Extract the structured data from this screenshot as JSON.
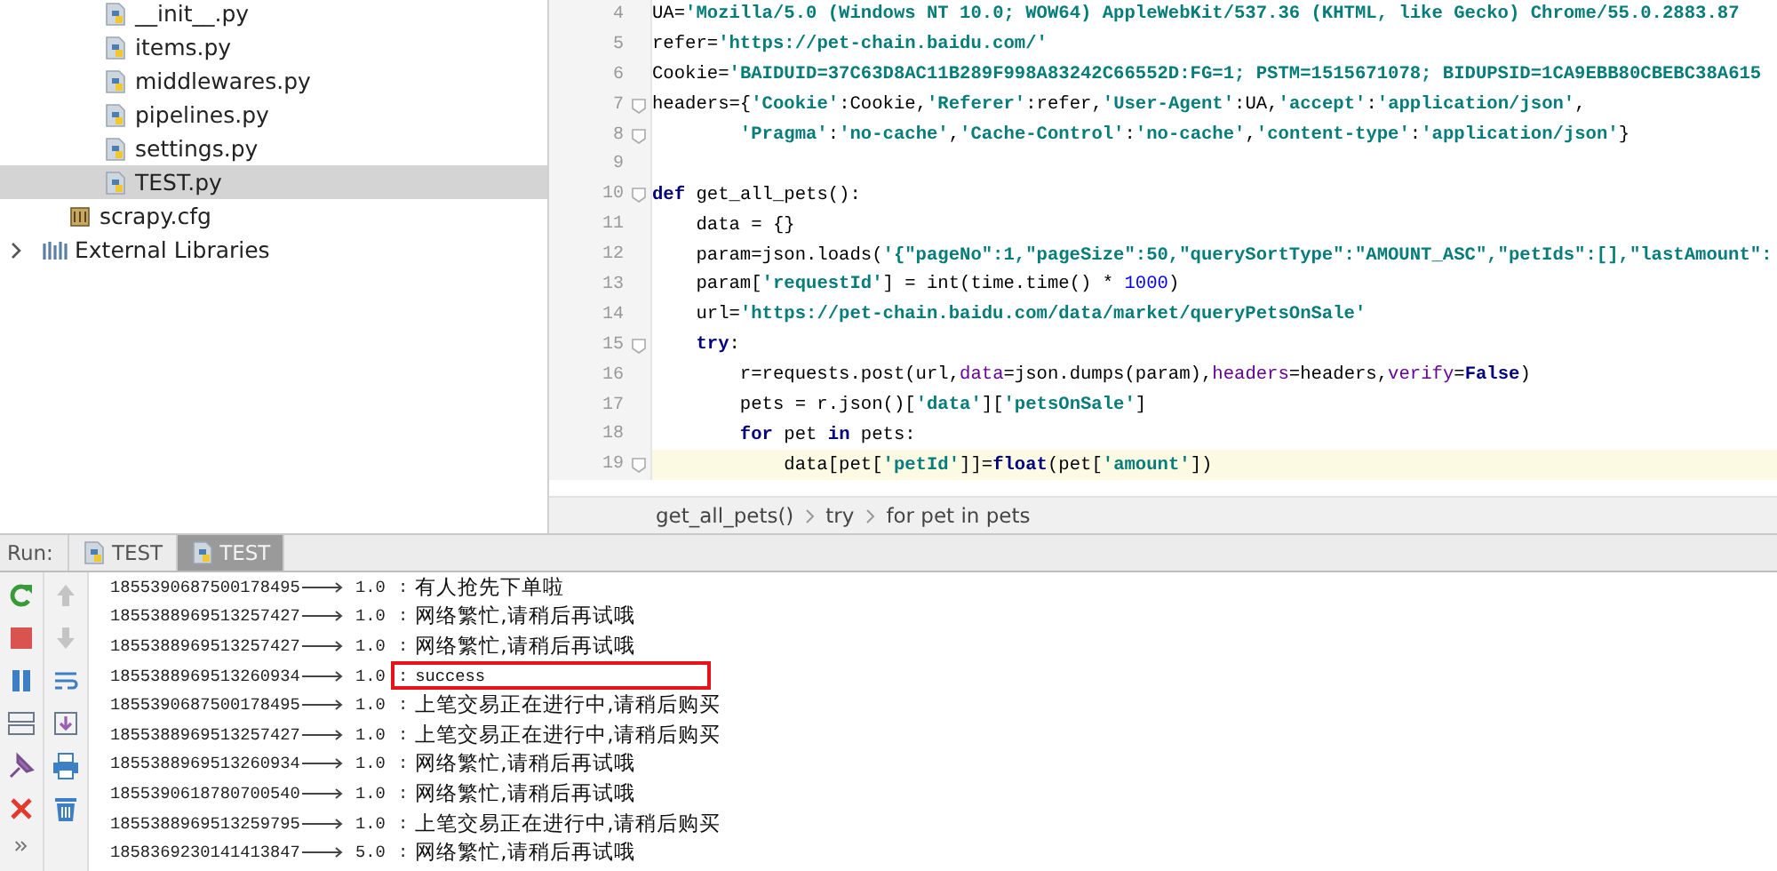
{
  "project_files": [
    {
      "name": "__init__.py",
      "kind": "python",
      "selected": false
    },
    {
      "name": "items.py",
      "kind": "python",
      "selected": false
    },
    {
      "name": "middlewares.py",
      "kind": "python",
      "selected": false
    },
    {
      "name": "pipelines.py",
      "kind": "python",
      "selected": false
    },
    {
      "name": "settings.py",
      "kind": "python",
      "selected": false
    },
    {
      "name": "TEST.py",
      "kind": "python",
      "selected": true
    }
  ],
  "project_root_items": [
    {
      "name": "scrapy.cfg",
      "kind": "config",
      "selected": false
    }
  ],
  "external_libraries": {
    "name": "External Libraries",
    "kind": "library",
    "expanded": false,
    "selected": false
  },
  "editor": {
    "lines": [
      {
        "number": "4",
        "fold": false,
        "current": false,
        "tokens": [
          {
            "kind": "plain",
            "text": "UA="
          },
          {
            "kind": "string",
            "text": "'Mozilla/5.0 (Windows NT 10.0; WOW64) AppleWebKit/537.36 (KHTML, like Gecko) Chrome/55.0.2883.87"
          }
        ]
      },
      {
        "number": "5",
        "fold": false,
        "current": false,
        "tokens": [
          {
            "kind": "plain",
            "text": "refer="
          },
          {
            "kind": "string",
            "text": "'https://pet-chain.baidu.com/'"
          }
        ]
      },
      {
        "number": "6",
        "fold": false,
        "current": false,
        "tokens": [
          {
            "kind": "plain",
            "text": "Cookie="
          },
          {
            "kind": "string",
            "text": "'BAIDUID=37C63D8AC11B289F998A83242C66552D:FG=1; PSTM=1515671078; BIDUPSID=1CA9EBB80CBEBC38A615"
          }
        ]
      },
      {
        "number": "7",
        "fold": true,
        "current": false,
        "tokens": [
          {
            "kind": "plain",
            "text": "headers={"
          },
          {
            "kind": "string",
            "text": "'Cookie'"
          },
          {
            "kind": "plain",
            "text": ":Cookie,"
          },
          {
            "kind": "string",
            "text": "'Referer'"
          },
          {
            "kind": "plain",
            "text": ":refer,"
          },
          {
            "kind": "string",
            "text": "'User-Agent'"
          },
          {
            "kind": "plain",
            "text": ":UA,"
          },
          {
            "kind": "string",
            "text": "'accept'"
          },
          {
            "kind": "plain",
            "text": ":"
          },
          {
            "kind": "string",
            "text": "'application/json'"
          },
          {
            "kind": "plain",
            "text": ","
          }
        ]
      },
      {
        "number": "8",
        "fold": true,
        "current": false,
        "tokens": [
          {
            "kind": "string",
            "text": "        'Pragma'"
          },
          {
            "kind": "plain",
            "text": ":"
          },
          {
            "kind": "string",
            "text": "'no-cache'"
          },
          {
            "kind": "plain",
            "text": ","
          },
          {
            "kind": "string",
            "text": "'Cache-Control'"
          },
          {
            "kind": "plain",
            "text": ":"
          },
          {
            "kind": "string",
            "text": "'no-cache'"
          },
          {
            "kind": "plain",
            "text": ","
          },
          {
            "kind": "string",
            "text": "'content-type'"
          },
          {
            "kind": "plain",
            "text": ":"
          },
          {
            "kind": "string",
            "text": "'application/json'"
          },
          {
            "kind": "plain",
            "text": "}"
          }
        ]
      },
      {
        "number": "9",
        "fold": false,
        "current": false
      },
      {
        "number": "10",
        "fold": true,
        "current": false,
        "tokens": [
          {
            "kind": "keyword",
            "text": "def"
          },
          {
            "kind": "plain",
            "text": " get_all_pets():"
          }
        ]
      },
      {
        "number": "11",
        "fold": false,
        "current": false,
        "tokens": [
          {
            "kind": "plain",
            "text": "    data = {}"
          }
        ]
      },
      {
        "number": "12",
        "fold": false,
        "current": false,
        "tokens": [
          {
            "kind": "plain",
            "text": "    param=json.loads("
          },
          {
            "kind": "string",
            "text": "'{\"pageNo\":1,\"pageSize\":50,\"querySortType\":\"AMOUNT_ASC\",\"petIds\":[],\"lastAmount\":"
          }
        ]
      },
      {
        "number": "13",
        "fold": false,
        "current": false,
        "tokens": [
          {
            "kind": "plain",
            "text": "    param["
          },
          {
            "kind": "string",
            "text": "'requestId'"
          },
          {
            "kind": "plain",
            "text": "] = int(time.time() * "
          },
          {
            "kind": "number",
            "text": "1000"
          },
          {
            "kind": "plain",
            "text": ")"
          }
        ]
      },
      {
        "number": "14",
        "fold": false,
        "current": false,
        "tokens": [
          {
            "kind": "plain",
            "text": "    url="
          },
          {
            "kind": "string",
            "text": "'https://pet-chain.baidu.com/data/market/queryPetsOnSale'"
          }
        ]
      },
      {
        "number": "15",
        "fold": true,
        "current": false,
        "tokens": [
          {
            "kind": "keyword",
            "text": "    try"
          },
          {
            "kind": "plain",
            "text": ":"
          }
        ]
      },
      {
        "number": "16",
        "fold": false,
        "current": false,
        "tokens": [
          {
            "kind": "plain",
            "text": "        r=requests.post(url,"
          },
          {
            "kind": "param",
            "text": "data"
          },
          {
            "kind": "plain",
            "text": "=json.dumps(param),"
          },
          {
            "kind": "param",
            "text": "headers"
          },
          {
            "kind": "plain",
            "text": "=headers,"
          },
          {
            "kind": "param",
            "text": "verify"
          },
          {
            "kind": "plain",
            "text": "="
          },
          {
            "kind": "keyword",
            "text": "False"
          },
          {
            "kind": "plain",
            "text": ")"
          }
        ]
      },
      {
        "number": "17",
        "fold": false,
        "current": false,
        "tokens": [
          {
            "kind": "plain",
            "text": "        pets = r.json()["
          },
          {
            "kind": "string",
            "text": "'data'"
          },
          {
            "kind": "plain",
            "text": "]["
          },
          {
            "kind": "string",
            "text": "'petsOnSale'"
          },
          {
            "kind": "plain",
            "text": "]"
          }
        ]
      },
      {
        "number": "18",
        "fold": false,
        "current": false,
        "tokens": [
          {
            "kind": "keyword",
            "text": "        for"
          },
          {
            "kind": "plain",
            "text": " pet "
          },
          {
            "kind": "keyword",
            "text": "in"
          },
          {
            "kind": "plain",
            "text": " pets:"
          }
        ]
      },
      {
        "number": "19",
        "fold": true,
        "current": true,
        "tokens": [
          {
            "kind": "plain",
            "text": "            data[pet["
          },
          {
            "kind": "string",
            "text": "'petId'"
          },
          {
            "kind": "plain",
            "text": "]]="
          },
          {
            "kind": "keyword",
            "text": "float"
          },
          {
            "kind": "plain",
            "text": "(pet["
          },
          {
            "kind": "string",
            "text": "'amount'"
          },
          {
            "kind": "plain",
            "text": "])"
          }
        ]
      }
    ],
    "breadcrumbs": [
      "get_all_pets()",
      "try",
      "for pet in pets"
    ]
  },
  "run": {
    "label": "Run:",
    "tabs": [
      {
        "label": "TEST",
        "selected": false
      },
      {
        "label": "TEST",
        "selected": true
      }
    ],
    "lines": [
      {
        "id": "1855390687500178495",
        "value": "1.0",
        "sep": ":",
        "message": "有人抢先下单啦",
        "highlighted": false
      },
      {
        "id": "1855388969513257427",
        "value": "1.0",
        "sep": ":",
        "message": "网络繁忙,请稍后再试哦",
        "highlighted": false
      },
      {
        "id": "1855388969513257427",
        "value": "1.0",
        "sep": ":",
        "message": "网络繁忙,请稍后再试哦",
        "highlighted": false
      },
      {
        "id": "1855388969513260934",
        "value": "1.0",
        "sep": ":",
        "message": "success",
        "highlighted": true
      },
      {
        "id": "1855390687500178495",
        "value": "1.0",
        "sep": ":",
        "message": "上笔交易正在进行中,请稍后购买",
        "highlighted": false
      },
      {
        "id": "1855388969513257427",
        "value": "1.0",
        "sep": ":",
        "message": "上笔交易正在进行中,请稍后购买",
        "highlighted": false
      },
      {
        "id": "1855388969513260934",
        "value": "1.0",
        "sep": ":",
        "message": "网络繁忙,请稍后再试哦",
        "highlighted": false
      },
      {
        "id": "1855390618780700540",
        "value": "1.0",
        "sep": ":",
        "message": "网络繁忙,请稍后再试哦",
        "highlighted": false
      },
      {
        "id": "1855388969513259795",
        "value": "1.0",
        "sep": ":",
        "message": "上笔交易正在进行中,请稍后购买",
        "highlighted": false
      },
      {
        "id": "1858369230141413847",
        "value": "5.0",
        "sep": ":",
        "message": "网络繁忙,请稍后再试哦",
        "highlighted": false
      }
    ]
  }
}
